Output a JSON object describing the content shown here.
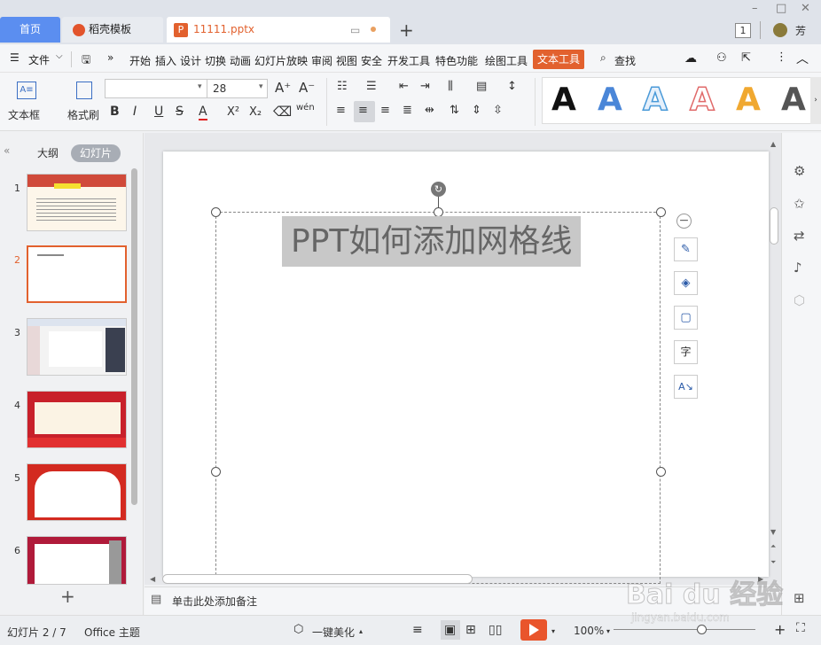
{
  "titlebar": {
    "tab_home": "首页",
    "tab_wps": "稻壳模板",
    "tab_file": "11111.pptx",
    "window_badge": "1",
    "user_name": "芳"
  },
  "menu": {
    "file": "文件",
    "items": [
      "开始",
      "插入",
      "设计",
      "切换",
      "动画",
      "幻灯片放映",
      "审阅",
      "视图",
      "安全",
      "开发工具",
      "特色功能",
      "绘图工具"
    ],
    "active": "文本工具",
    "search": "查找"
  },
  "toolbar": {
    "textbox_label": "文本框",
    "format_painter_label": "格式刷",
    "font_name": "",
    "font_size": "28",
    "bold": "B",
    "italic": "I",
    "underline": "U",
    "strike": "S",
    "font_color": "A",
    "superscript": "X²",
    "subscript": "X₂",
    "phonetic": "wén",
    "grow": "A⁺",
    "shrink": "A⁻",
    "gallery_letter": "A"
  },
  "left_panel": {
    "tab_outline": "大纲",
    "tab_slides": "幻灯片",
    "slide_numbers": [
      "1",
      "2",
      "3",
      "4",
      "5",
      "6"
    ],
    "current_slide_index": 1,
    "add_slide": "+"
  },
  "slide": {
    "title": "PPT如何添加网格线"
  },
  "notes": {
    "placeholder": "单击此处添加备注"
  },
  "status": {
    "slide_indicator": "幻灯片 2 / 7",
    "theme": "Office 主题",
    "beautify": "一键美化",
    "zoom": "100%"
  },
  "colors": {
    "accent": "#e2612e",
    "home_tab": "#5b8ef0",
    "play": "#e9552c"
  },
  "watermark": {
    "brand": "Bai du 经验",
    "url": "jingyan.baidu.com"
  }
}
